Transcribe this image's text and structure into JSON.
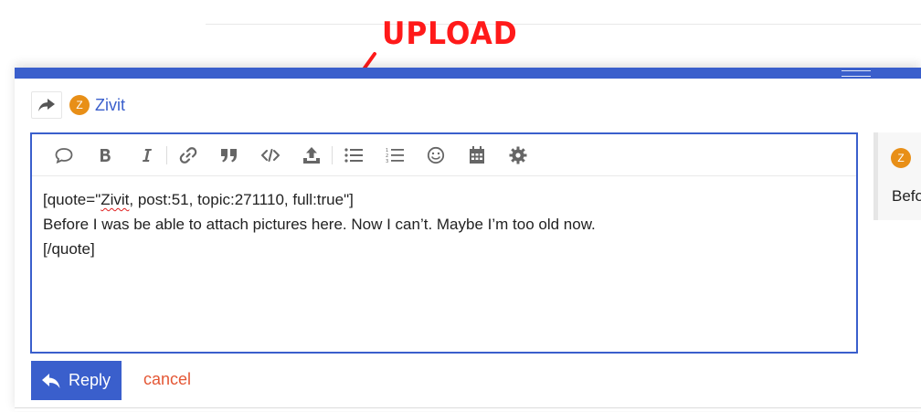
{
  "annotation": {
    "label": "UPLOAD",
    "color": "#ff1a1a"
  },
  "composer": {
    "accent_color": "#3a5fcc",
    "reply_to": {
      "avatar_letter": "Z",
      "name": "Zivit",
      "avatar_color": "#e88f17"
    },
    "toolbar": {
      "buttons": [
        "quote-icon",
        "bold-icon",
        "italic-icon",
        "link-icon",
        "blockquote-icon",
        "code-icon",
        "upload-icon",
        "bullet-list-icon",
        "numbered-list-icon",
        "emoji-icon",
        "calendar-icon",
        "gear-icon"
      ]
    },
    "editor": {
      "line1_prefix": "[quote=\"",
      "line1_misspelled": "Zivit",
      "line1_suffix": ", post:51, topic:271110, full:true\"]",
      "line2": "Before I was be able to attach pictures here. Now I can’t. Maybe I’m too old now.",
      "line3": "[/quote]"
    },
    "preview": {
      "avatar_letter": "Z",
      "text": "Before"
    },
    "actions": {
      "reply_label": "Reply",
      "cancel_label": "cancel",
      "cancel_color": "#e45735"
    }
  }
}
